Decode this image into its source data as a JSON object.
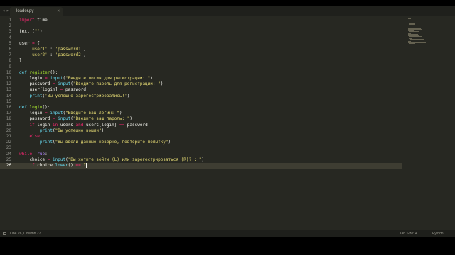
{
  "window": {
    "tab": {
      "label": "loader.py",
      "close": "×"
    },
    "nav": {
      "left": "◂",
      "right": "▸"
    }
  },
  "code_lines": [
    {
      "n": "1",
      "tokens": [
        {
          "t": "import",
          "c": "#f92672"
        },
        {
          "t": " time",
          "c": "#f8f8f2"
        }
      ]
    },
    {
      "n": "2",
      "tokens": []
    },
    {
      "n": "3",
      "tokens": [
        {
          "t": "text",
          "c": "#f8f8f2"
        },
        {
          "t": " (",
          "c": "#f8f8f2"
        },
        {
          "t": "\"\"",
          "c": "#e6db74"
        },
        {
          "t": ")",
          "c": "#f8f8f2"
        }
      ]
    },
    {
      "n": "4",
      "tokens": []
    },
    {
      "n": "5",
      "tokens": [
        {
          "t": "user ",
          "c": "#f8f8f2"
        },
        {
          "t": "=",
          "c": "#f92672"
        },
        {
          "t": " {",
          "c": "#f8f8f2"
        }
      ]
    },
    {
      "n": "6",
      "tokens": [
        {
          "t": "    ",
          "c": "#f8f8f2"
        },
        {
          "t": "'user1'",
          "c": "#e6db74"
        },
        {
          "t": " : ",
          "c": "#f8f8f2"
        },
        {
          "t": "'password1'",
          "c": "#e6db74"
        },
        {
          "t": ",",
          "c": "#f8f8f2"
        }
      ]
    },
    {
      "n": "7",
      "tokens": [
        {
          "t": "    ",
          "c": "#f8f8f2"
        },
        {
          "t": "'user2'",
          "c": "#e6db74"
        },
        {
          "t": " : ",
          "c": "#f8f8f2"
        },
        {
          "t": "'password2'",
          "c": "#e6db74"
        },
        {
          "t": ",",
          "c": "#f8f8f2"
        }
      ]
    },
    {
      "n": "8",
      "tokens": [
        {
          "t": "}",
          "c": "#f8f8f2"
        }
      ]
    },
    {
      "n": "9",
      "tokens": []
    },
    {
      "n": "10",
      "tokens": [
        {
          "t": "def",
          "c": "#66d9ef"
        },
        {
          "t": " ",
          "c": "#f8f8f2"
        },
        {
          "t": "register",
          "c": "#a6e22e"
        },
        {
          "t": "():",
          "c": "#f8f8f2"
        }
      ]
    },
    {
      "n": "11",
      "tokens": [
        {
          "t": "    login ",
          "c": "#f8f8f2"
        },
        {
          "t": "=",
          "c": "#f92672"
        },
        {
          "t": " ",
          "c": "#f8f8f2"
        },
        {
          "t": "input",
          "c": "#66d9ef"
        },
        {
          "t": "(",
          "c": "#f8f8f2"
        },
        {
          "t": "\"Введите логин для регистрации: \"",
          "c": "#e6db74"
        },
        {
          "t": ")",
          "c": "#f8f8f2"
        }
      ]
    },
    {
      "n": "12",
      "tokens": [
        {
          "t": "    password ",
          "c": "#f8f8f2"
        },
        {
          "t": "=",
          "c": "#f92672"
        },
        {
          "t": " ",
          "c": "#f8f8f2"
        },
        {
          "t": "input",
          "c": "#66d9ef"
        },
        {
          "t": "(",
          "c": "#f8f8f2"
        },
        {
          "t": "\"Введите пароль для регистрации: \"",
          "c": "#e6db74"
        },
        {
          "t": ")",
          "c": "#f8f8f2"
        }
      ]
    },
    {
      "n": "13",
      "tokens": [
        {
          "t": "    user[login] ",
          "c": "#f8f8f2"
        },
        {
          "t": "=",
          "c": "#f92672"
        },
        {
          "t": " password",
          "c": "#f8f8f2"
        }
      ]
    },
    {
      "n": "14",
      "tokens": [
        {
          "t": "    ",
          "c": "#f8f8f2"
        },
        {
          "t": "print",
          "c": "#66d9ef"
        },
        {
          "t": "(",
          "c": "#f8f8f2"
        },
        {
          "t": "'Вы успешно зарегестрировались!'",
          "c": "#e6db74"
        },
        {
          "t": ")",
          "c": "#f8f8f2"
        }
      ]
    },
    {
      "n": "15",
      "tokens": []
    },
    {
      "n": "16",
      "tokens": [
        {
          "t": "def",
          "c": "#66d9ef"
        },
        {
          "t": " ",
          "c": "#f8f8f2"
        },
        {
          "t": "login",
          "c": "#a6e22e"
        },
        {
          "t": "():",
          "c": "#f8f8f2"
        }
      ]
    },
    {
      "n": "17",
      "tokens": [
        {
          "t": "    login ",
          "c": "#f8f8f2"
        },
        {
          "t": "=",
          "c": "#f92672"
        },
        {
          "t": " ",
          "c": "#f8f8f2"
        },
        {
          "t": "input",
          "c": "#66d9ef"
        },
        {
          "t": "(",
          "c": "#f8f8f2"
        },
        {
          "t": "\"Введите ваш логин: \"",
          "c": "#e6db74"
        },
        {
          "t": ")",
          "c": "#f8f8f2"
        }
      ]
    },
    {
      "n": "18",
      "tokens": [
        {
          "t": "    password ",
          "c": "#f8f8f2"
        },
        {
          "t": "=",
          "c": "#f92672"
        },
        {
          "t": " ",
          "c": "#f8f8f2"
        },
        {
          "t": "input",
          "c": "#66d9ef"
        },
        {
          "t": "(",
          "c": "#f8f8f2"
        },
        {
          "t": "\"Введите ваш пароль: \"",
          "c": "#e6db74"
        },
        {
          "t": ")",
          "c": "#f8f8f2"
        }
      ]
    },
    {
      "n": "19",
      "tokens": [
        {
          "t": "    ",
          "c": "#f8f8f2"
        },
        {
          "t": "if",
          "c": "#f92672"
        },
        {
          "t": " login ",
          "c": "#f8f8f2"
        },
        {
          "t": "in",
          "c": "#f92672"
        },
        {
          "t": " users ",
          "c": "#f8f8f2"
        },
        {
          "t": "and",
          "c": "#f92672"
        },
        {
          "t": " users[login] ",
          "c": "#f8f8f2"
        },
        {
          "t": "==",
          "c": "#f92672"
        },
        {
          "t": " password:",
          "c": "#f8f8f2"
        }
      ]
    },
    {
      "n": "20",
      "tokens": [
        {
          "t": "        ",
          "c": "#f8f8f2"
        },
        {
          "t": "print",
          "c": "#66d9ef"
        },
        {
          "t": "(",
          "c": "#f8f8f2"
        },
        {
          "t": "\"Вы успешно вошли\"",
          "c": "#e6db74"
        },
        {
          "t": ")",
          "c": "#f8f8f2"
        }
      ]
    },
    {
      "n": "21",
      "tokens": [
        {
          "t": "    ",
          "c": "#f8f8f2"
        },
        {
          "t": "else",
          "c": "#f92672"
        },
        {
          "t": ":",
          "c": "#f8f8f2"
        }
      ]
    },
    {
      "n": "22",
      "tokens": [
        {
          "t": "        ",
          "c": "#f8f8f2"
        },
        {
          "t": "print",
          "c": "#66d9ef"
        },
        {
          "t": "(",
          "c": "#f8f8f2"
        },
        {
          "t": "\"Вы ввели данные неверно, повторите попытку\"",
          "c": "#e6db74"
        },
        {
          "t": ")",
          "c": "#f8f8f2"
        }
      ]
    },
    {
      "n": "23",
      "tokens": []
    },
    {
      "n": "24",
      "tokens": [
        {
          "t": "while",
          "c": "#f92672"
        },
        {
          "t": " ",
          "c": "#f8f8f2"
        },
        {
          "t": "True",
          "c": "#ae81ff"
        },
        {
          "t": ":",
          "c": "#f8f8f2"
        }
      ]
    },
    {
      "n": "25",
      "tokens": [
        {
          "t": "    choice ",
          "c": "#f8f8f2"
        },
        {
          "t": "=",
          "c": "#f92672"
        },
        {
          "t": " ",
          "c": "#f8f8f2"
        },
        {
          "t": "input",
          "c": "#66d9ef"
        },
        {
          "t": "(",
          "c": "#f8f8f2"
        },
        {
          "t": "\"Вы хотите войти (L) или зарегестрироваться (R)? : \"",
          "c": "#e6db74"
        },
        {
          "t": ")",
          "c": "#f8f8f2"
        }
      ]
    },
    {
      "n": "26",
      "active": true,
      "cursor": true,
      "tokens": [
        {
          "t": "    ",
          "c": "#f8f8f2"
        },
        {
          "t": "if",
          "c": "#f92672"
        },
        {
          "t": " choice.",
          "c": "#f8f8f2"
        },
        {
          "t": "lower",
          "c": "#66d9ef"
        },
        {
          "t": "() ",
          "c": "#f8f8f2"
        },
        {
          "t": "==",
          "c": "#f92672"
        },
        {
          "t": " ",
          "c": "#f8f8f2"
        },
        {
          "t": "I",
          "c": "#e6db74"
        }
      ]
    }
  ],
  "status": {
    "position": "Line 26, Column 27",
    "tab_size": "Tab Size: 4",
    "syntax": "Python"
  },
  "colors": {
    "background": "#272822",
    "keyword": "#f92672",
    "string": "#e6db74",
    "builtin": "#66d9ef",
    "function": "#a6e22e",
    "constant": "#ae81ff"
  }
}
